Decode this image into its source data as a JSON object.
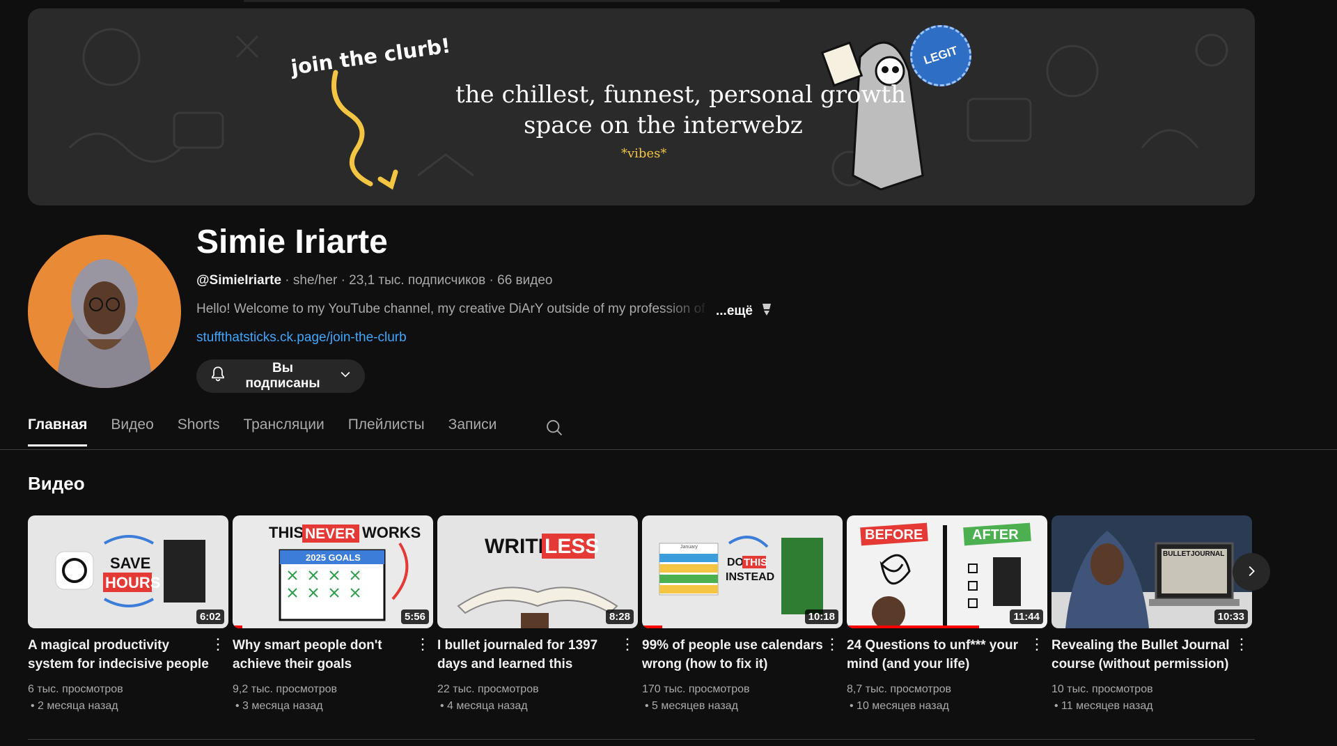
{
  "banner": {
    "join_text": "join the clurb!",
    "tagline_line1": "the chillest, funnest, personal growth",
    "tagline_line2": "space on the interwebz",
    "vibes": "*vibes*",
    "badge": "LEGIT"
  },
  "channel": {
    "name": "Simie Iriarte",
    "handle": "@SimieIriarte",
    "meta_rest": " · she/her · 23,1 тыс. подписчиков · 66 видео",
    "description": "Hello! Welcome to my YouTube channel, my creative DiArY outside of my profession of",
    "more": "...ещё",
    "link": "stuffthatsticks.ck.page/join-the-clurb",
    "subscribe_label": "Вы подписаны"
  },
  "tabs": [
    "Главная",
    "Видео",
    "Shorts",
    "Трансляции",
    "Плейлисты",
    "Записи"
  ],
  "section": {
    "title": "Видео"
  },
  "videos": [
    {
      "title": "A magical productivity system for indecisive people",
      "duration": "6:02",
      "views": "6 тыс. просмотров",
      "ago": "• 2 месяца назад",
      "thumb_text": [
        "SAVE",
        "HOURS"
      ],
      "watched": 0
    },
    {
      "title": "Why smart people don't achieve their goals",
      "duration": "5:56",
      "views": "9,2 тыс. просмотров",
      "ago": "• 3 месяца назад",
      "thumb_text": [
        "THIS",
        "NEVER",
        "WORKS",
        "2025 GOALS"
      ],
      "watched": 0.05
    },
    {
      "title": "I bullet journaled for 1397 days and learned this",
      "duration": "8:28",
      "views": "22 тыс. просмотров",
      "ago": "• 4 месяца назад",
      "thumb_text": [
        "WRITE",
        "LESS"
      ],
      "watched": 0
    },
    {
      "title": "99% of people use calendars wrong (how to fix it)",
      "duration": "10:18",
      "views": "170 тыс. просмотров",
      "ago": "• 5 месяцев назад",
      "thumb_text": [
        "DO",
        "THIS",
        "INSTEAD",
        "January"
      ],
      "watched": 0.1
    },
    {
      "title": "24 Questions to unf*** your mind (and your life)",
      "duration": "11:44",
      "views": "8,7 тыс. просмотров",
      "ago": "• 10 месяцев назад",
      "thumb_text": [
        "BEFORE",
        "AFTER"
      ],
      "watched": 0.66
    },
    {
      "title": "Revealing the Bullet Journal course (without permission)",
      "duration": "10:33",
      "views": "10 тыс. просмотров",
      "ago": "• 11 месяцев назад",
      "thumb_text": [
        "BULLET",
        "JOURNAL"
      ],
      "watched": 0
    }
  ],
  "icons": {
    "bell": "bell-icon",
    "chevron": "chevron-down-icon",
    "search": "search-icon",
    "next": "chevron-right-icon",
    "menu": "⋮"
  },
  "colors": {
    "background": "#0f0f0f",
    "link": "#3ea6ff",
    "progress": "#ff0000"
  }
}
